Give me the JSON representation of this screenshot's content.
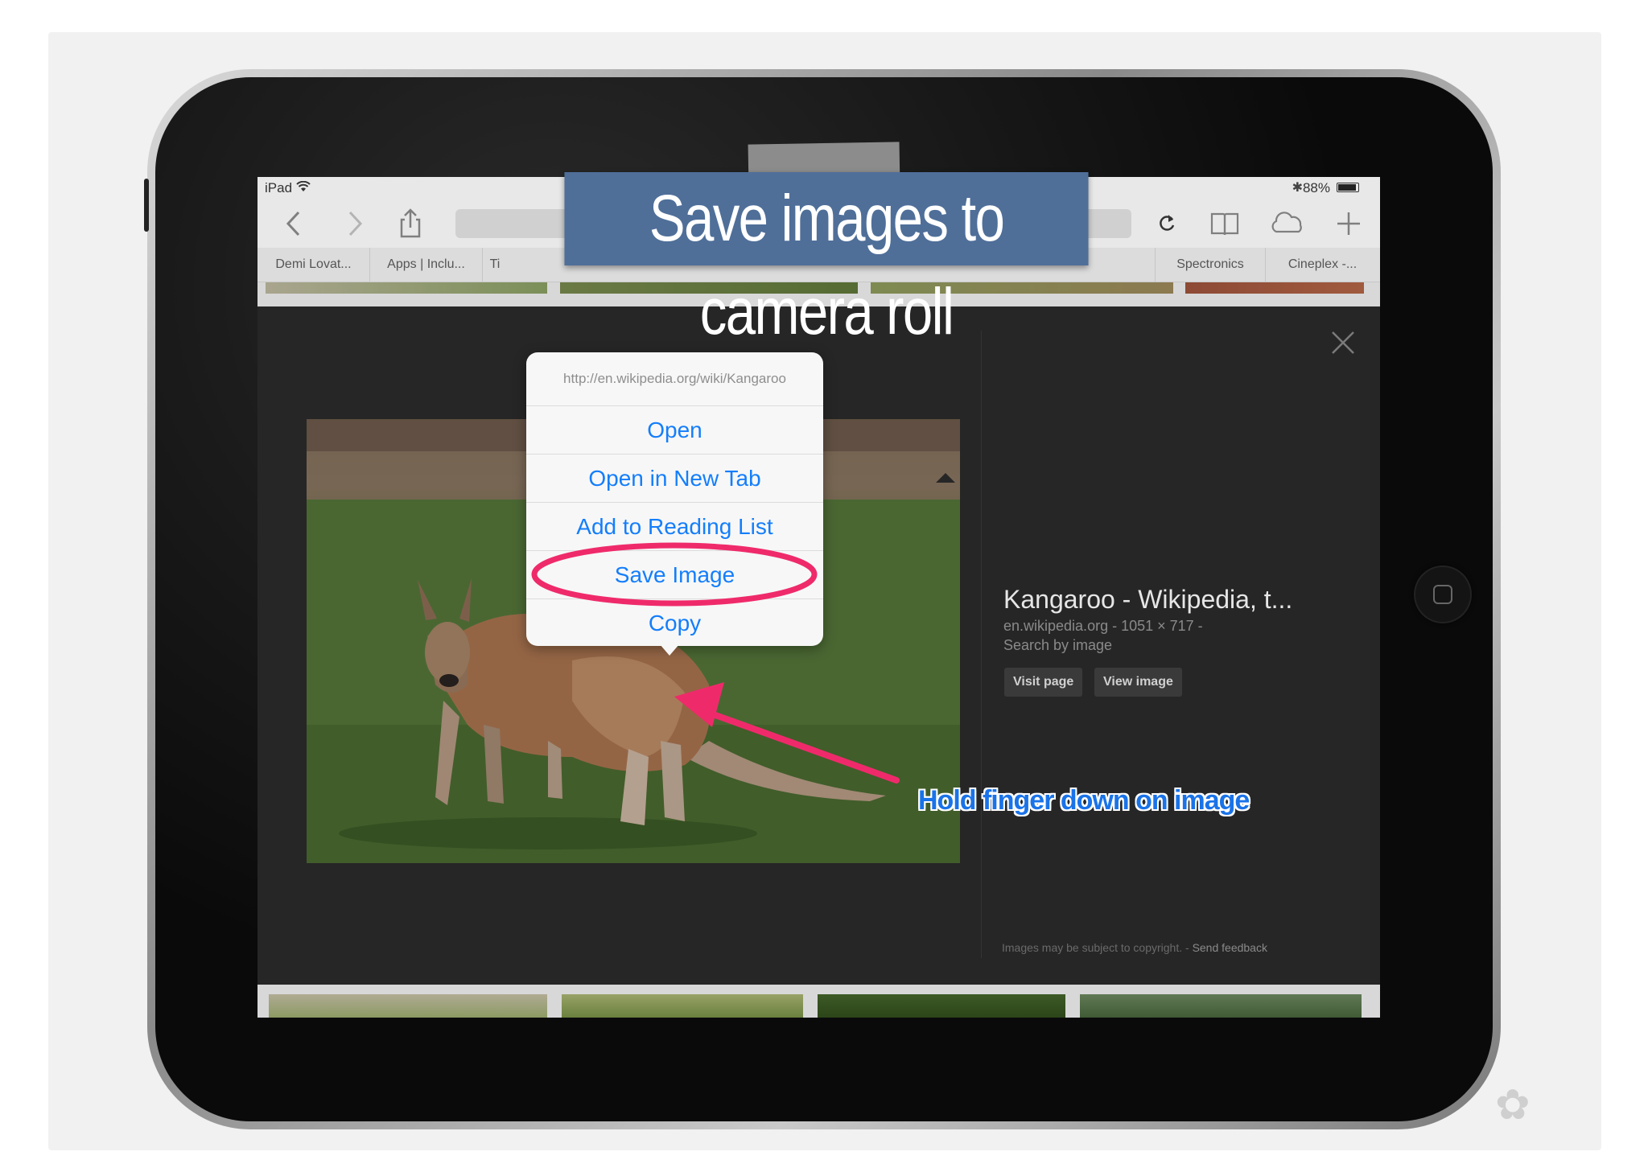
{
  "status_bar": {
    "carrier": "iPad",
    "wifi_icon": "wifi-icon",
    "bluetooth_icon": "bluetooth-icon",
    "battery": "88%"
  },
  "toolbar": {
    "back_icon": "chevron-left-icon",
    "forward_icon": "chevron-right-icon",
    "share_icon": "share-icon",
    "reload_icon": "reload-icon",
    "bookmarks_icon": "book-icon",
    "icloud_tabs_icon": "cloud-icon",
    "new_tab_icon": "plus-icon"
  },
  "bookmarks": [
    "Demi Lovat...",
    "Apps | Inclu...",
    "Ti",
    "Spectronics",
    "Cineplex -..."
  ],
  "banner": {
    "title": "Save images to camera roll"
  },
  "context_menu": {
    "url": "http://en.wikipedia.org/wiki/Kangaroo",
    "items": [
      "Open",
      "Open in New Tab",
      "Add to Reading List",
      "Save Image",
      "Copy"
    ]
  },
  "result": {
    "title": "Kangaroo - Wikipedia, t...",
    "meta": "en.wikipedia.org - 1051 × 717 -",
    "search_by_image": "Search by image",
    "visit_page": "Visit page",
    "view_image": "View image",
    "close_icon": "close-icon"
  },
  "footer": {
    "copyright": "Images may be subject to copyright.",
    "send_feedback": "Send feedback"
  },
  "annotation": {
    "hint": "Hold finger down on image",
    "highlight_color": "#ef2a6b",
    "hint_color": "#1a73e8"
  },
  "colors": {
    "link_blue": "#147efb",
    "banner_blue": "#4f6f99"
  }
}
